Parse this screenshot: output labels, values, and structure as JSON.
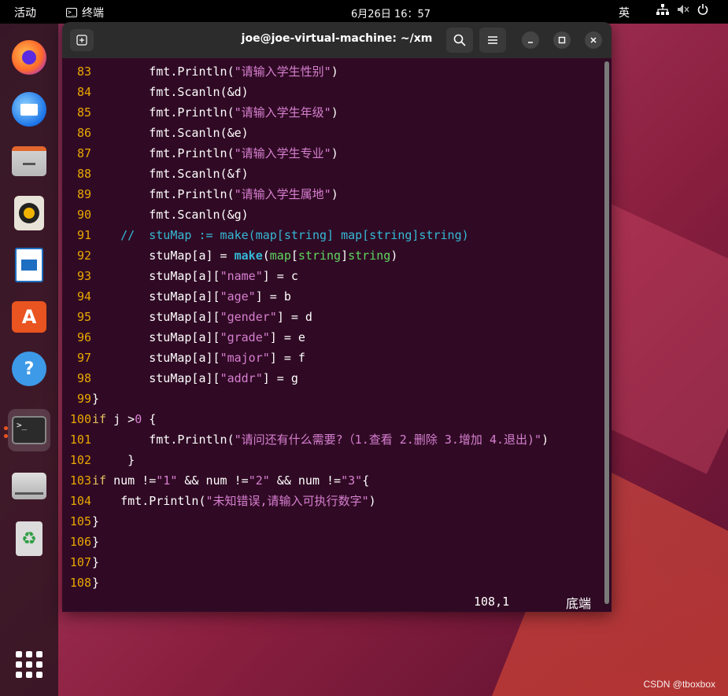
{
  "topbar": {
    "activities": "活动",
    "app_name": "终端",
    "clock": "6月26日  16：57",
    "ime": "英"
  },
  "window": {
    "title": "joe@joe-virtual-machine: ~/xm"
  },
  "code_lines": [
    {
      "n": "83",
      "segs": [
        [
          "",
          "        fmt.Println("
        ],
        [
          "str",
          "\"请输入学生性别\""
        ],
        [
          "",
          ")"
        ]
      ]
    },
    {
      "n": "84",
      "segs": [
        [
          "",
          "        fmt.Scanln(&d)"
        ]
      ]
    },
    {
      "n": "85",
      "segs": [
        [
          "",
          "        fmt.Println("
        ],
        [
          "str",
          "\"请输入学生年级\""
        ],
        [
          "",
          ")"
        ]
      ]
    },
    {
      "n": "86",
      "segs": [
        [
          "",
          "        fmt.Scanln(&e)"
        ]
      ]
    },
    {
      "n": "87",
      "segs": [
        [
          "",
          "        fmt.Println("
        ],
        [
          "str",
          "\"请输入学生专业\""
        ],
        [
          "",
          ")"
        ]
      ]
    },
    {
      "n": "88",
      "segs": [
        [
          "",
          "        fmt.Scanln(&f)"
        ]
      ]
    },
    {
      "n": "89",
      "segs": [
        [
          "",
          "        fmt.Println("
        ],
        [
          "str",
          "\"请输入学生属地\""
        ],
        [
          "",
          ")"
        ]
      ]
    },
    {
      "n": "90",
      "segs": [
        [
          "",
          "        fmt.Scanln(&g)"
        ]
      ]
    },
    {
      "n": "91",
      "segs": [
        [
          "cmt",
          "    //  stuMap := make(map[string] map[string]string)"
        ]
      ]
    },
    {
      "n": "92",
      "segs": [
        [
          "",
          "        stuMap[a] = "
        ],
        [
          "fn",
          "make"
        ],
        [
          "",
          "("
        ],
        [
          "typ",
          "map"
        ],
        [
          "",
          "["
        ],
        [
          "typ",
          "string"
        ],
        [
          "",
          "]"
        ],
        [
          "typ",
          "string"
        ],
        [
          "",
          ")"
        ]
      ]
    },
    {
      "n": "93",
      "segs": [
        [
          "",
          "        stuMap[a]["
        ],
        [
          "str",
          "\"name\""
        ],
        [
          "",
          "] = c"
        ]
      ]
    },
    {
      "n": "94",
      "segs": [
        [
          "",
          "        stuMap[a]["
        ],
        [
          "str",
          "\"age\""
        ],
        [
          "",
          "] = b"
        ]
      ]
    },
    {
      "n": "95",
      "segs": [
        [
          "",
          "        stuMap[a]["
        ],
        [
          "str",
          "\"gender\""
        ],
        [
          "",
          "] = d"
        ]
      ]
    },
    {
      "n": "96",
      "segs": [
        [
          "",
          "        stuMap[a]["
        ],
        [
          "str",
          "\"grade\""
        ],
        [
          "",
          "] = e"
        ]
      ]
    },
    {
      "n": "97",
      "segs": [
        [
          "",
          "        stuMap[a]["
        ],
        [
          "str",
          "\"major\""
        ],
        [
          "",
          "] = f"
        ]
      ]
    },
    {
      "n": "98",
      "segs": [
        [
          "",
          "        stuMap[a]["
        ],
        [
          "str",
          "\"addr\""
        ],
        [
          "",
          "] = g"
        ]
      ]
    },
    {
      "n": "99",
      "segs": [
        [
          "",
          "}"
        ]
      ]
    },
    {
      "n": "100",
      "segs": [
        [
          "kw",
          "if"
        ],
        [
          "",
          " j >"
        ],
        [
          "num",
          "0"
        ],
        [
          "",
          " {"
        ]
      ]
    },
    {
      "n": "101",
      "segs": [
        [
          "",
          "        fmt.Println("
        ],
        [
          "str",
          "\"请问还有什么需要?（1.查看 2.删除 3.增加 4.退出)\""
        ],
        [
          "",
          ")"
        ]
      ]
    },
    {
      "n": "102",
      "segs": [
        [
          "",
          "     }"
        ]
      ]
    },
    {
      "n": "103",
      "segs": [
        [
          "kw",
          "if"
        ],
        [
          "",
          " num !="
        ],
        [
          "str",
          "\"1\""
        ],
        [
          "",
          " && num !="
        ],
        [
          "str",
          "\"2\""
        ],
        [
          "",
          " && num !="
        ],
        [
          "str",
          "\"3\""
        ],
        [
          "",
          "{"
        ]
      ]
    },
    {
      "n": "104",
      "segs": [
        [
          "",
          "    fmt.Println("
        ],
        [
          "str",
          "\"未知错误,请输入可执行数字\""
        ],
        [
          "",
          ")"
        ]
      ]
    },
    {
      "n": "105",
      "segs": [
        [
          "",
          "}"
        ]
      ]
    },
    {
      "n": "106",
      "segs": [
        [
          "",
          "}"
        ]
      ]
    },
    {
      "n": "107",
      "segs": [
        [
          "",
          "}"
        ]
      ]
    },
    {
      "n": "108",
      "segs": [
        [
          "",
          "}"
        ]
      ]
    }
  ],
  "status": {
    "position": "108,1",
    "where": "底端"
  },
  "watermark": "CSDN @tboxbox",
  "colors": {
    "terminal_bg": "#300a24",
    "line_number": "#e9a700",
    "string": "#d67fd0",
    "comment": "#34b9d6",
    "type": "#5fd75f",
    "keyword": "#e6c060"
  }
}
